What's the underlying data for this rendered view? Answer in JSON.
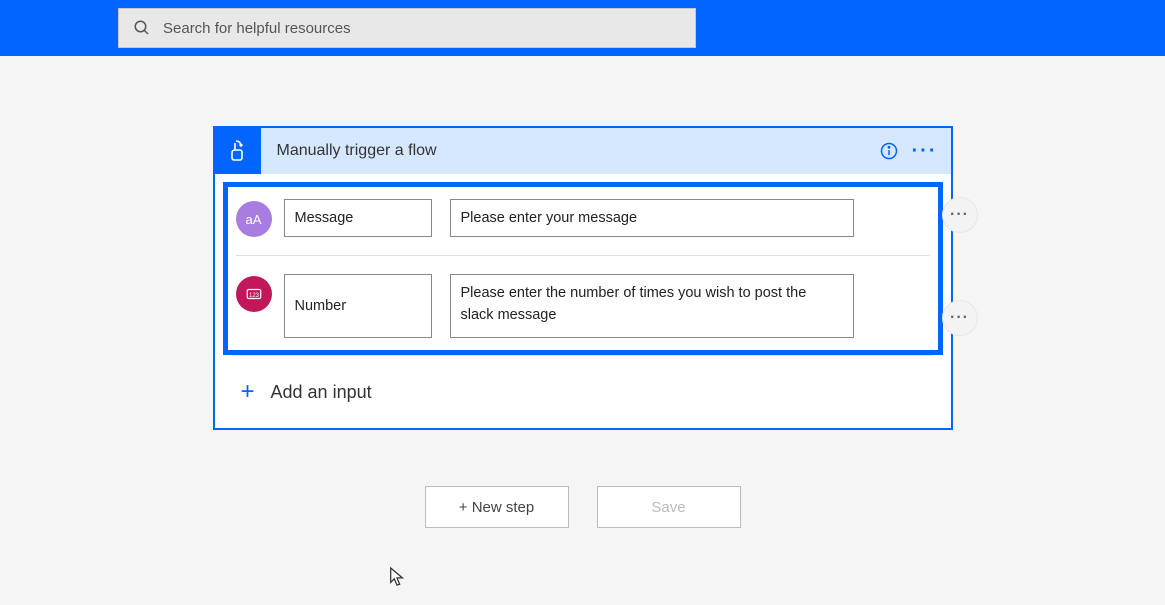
{
  "search": {
    "placeholder": "Search for helpful resources"
  },
  "card": {
    "title": "Manually trigger a flow",
    "inputs": [
      {
        "icon_type": "text",
        "icon_label": "aA",
        "name": "Message",
        "description": "Please enter your message"
      },
      {
        "icon_type": "number",
        "name": "Number",
        "description": "Please enter the number of times you wish to post the slack message"
      }
    ],
    "add_input_label": "Add an input"
  },
  "actions": {
    "new_step": "+ New step",
    "save": "Save"
  }
}
